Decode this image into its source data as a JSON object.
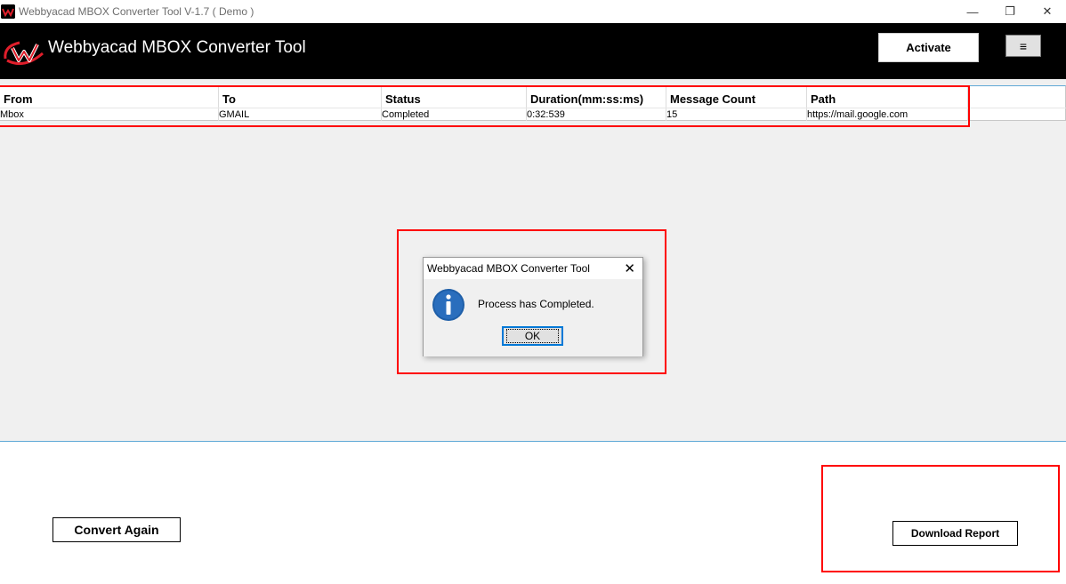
{
  "window": {
    "title": "Webbyacad MBOX Converter Tool V-1.7 ( Demo )",
    "controls": {
      "minimize": "—",
      "restore": "❐",
      "close": "✕"
    }
  },
  "header": {
    "brand": "Webbyacad MBOX Converter Tool",
    "activate_label": "Activate",
    "menu_label": "≡",
    "logo_icon": "webbyacad-w-logo"
  },
  "table": {
    "columns": [
      "From",
      "To",
      "Status",
      "Duration(mm:ss:ms)",
      "Message Count",
      "Path"
    ],
    "rows": [
      [
        "Mbox",
        "GMAIL",
        "Completed",
        "0:32:539",
        "15",
        "https://mail.google.com"
      ]
    ]
  },
  "dialog": {
    "title": "Webbyacad MBOX Converter Tool",
    "close_label": "✕",
    "message": "Process has Completed.",
    "ok_label": "OK",
    "icon": "info-icon"
  },
  "footer": {
    "convert_again_label": "Convert Again",
    "download_report_label": "Download Report"
  },
  "colors": {
    "header_bg": "#000000",
    "highlight_red": "#ff0000",
    "accent_blue": "#0078d7",
    "info_blue": "#1f5fa8",
    "content_bg": "#f0f0f0"
  }
}
